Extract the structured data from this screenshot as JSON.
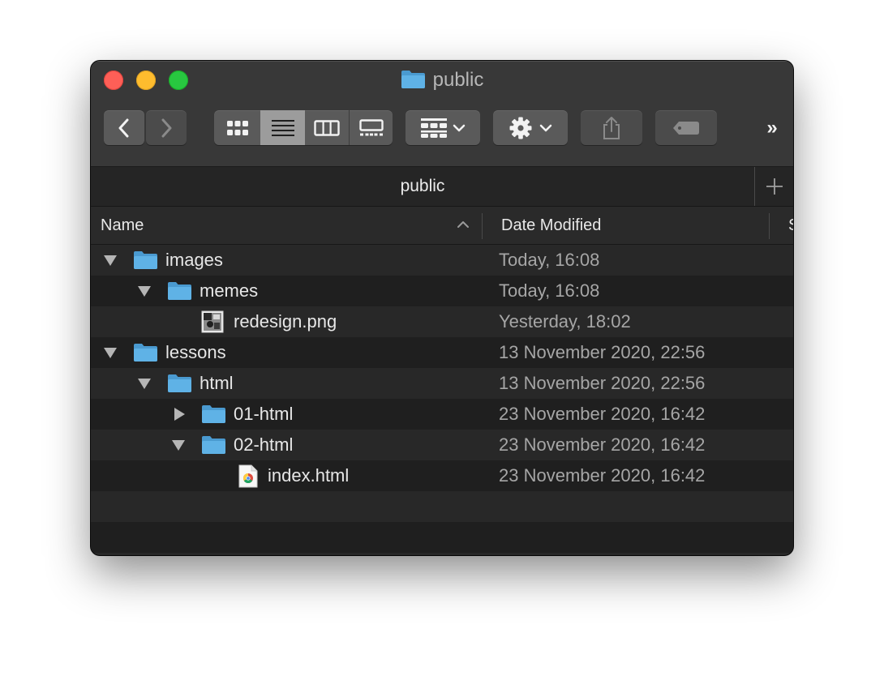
{
  "window": {
    "title": "public"
  },
  "toolbar": {
    "back_label": "Back",
    "forward_label": "Forward",
    "more_label": "»"
  },
  "tab": {
    "title": "public"
  },
  "columns": {
    "name": "Name",
    "date_modified": "Date Modified",
    "size_partial": "S"
  },
  "rows": [
    {
      "name": "images",
      "date": "Today, 16:08",
      "kind": "folder",
      "expanded": true
    },
    {
      "name": "memes",
      "date": "Today, 16:08",
      "kind": "folder",
      "expanded": true
    },
    {
      "name": "redesign.png",
      "date": "Yesterday, 18:02",
      "kind": "image"
    },
    {
      "name": "lessons",
      "date": "13 November 2020, 22:56",
      "kind": "folder",
      "expanded": true
    },
    {
      "name": "html",
      "date": "13 November 2020, 22:56",
      "kind": "folder",
      "expanded": true
    },
    {
      "name": "01-html",
      "date": "23 November 2020, 16:42",
      "kind": "folder",
      "expanded": false
    },
    {
      "name": "02-html",
      "date": "23 November 2020, 16:42",
      "kind": "folder",
      "expanded": true
    },
    {
      "name": "index.html",
      "date": "23 November 2020, 16:42",
      "kind": "html"
    }
  ],
  "colors": {
    "folder": "#5fb2e6",
    "close": "#fe5f57",
    "minimize": "#febc2e",
    "maximize": "#28c840"
  },
  "icons": {
    "view": [
      "icon-view-icon",
      "list-view-icon",
      "column-view-icon",
      "gallery-view-icon"
    ],
    "group": "group-icon",
    "action": "gear-icon",
    "share": "share-icon",
    "tags": "tag-icon"
  }
}
